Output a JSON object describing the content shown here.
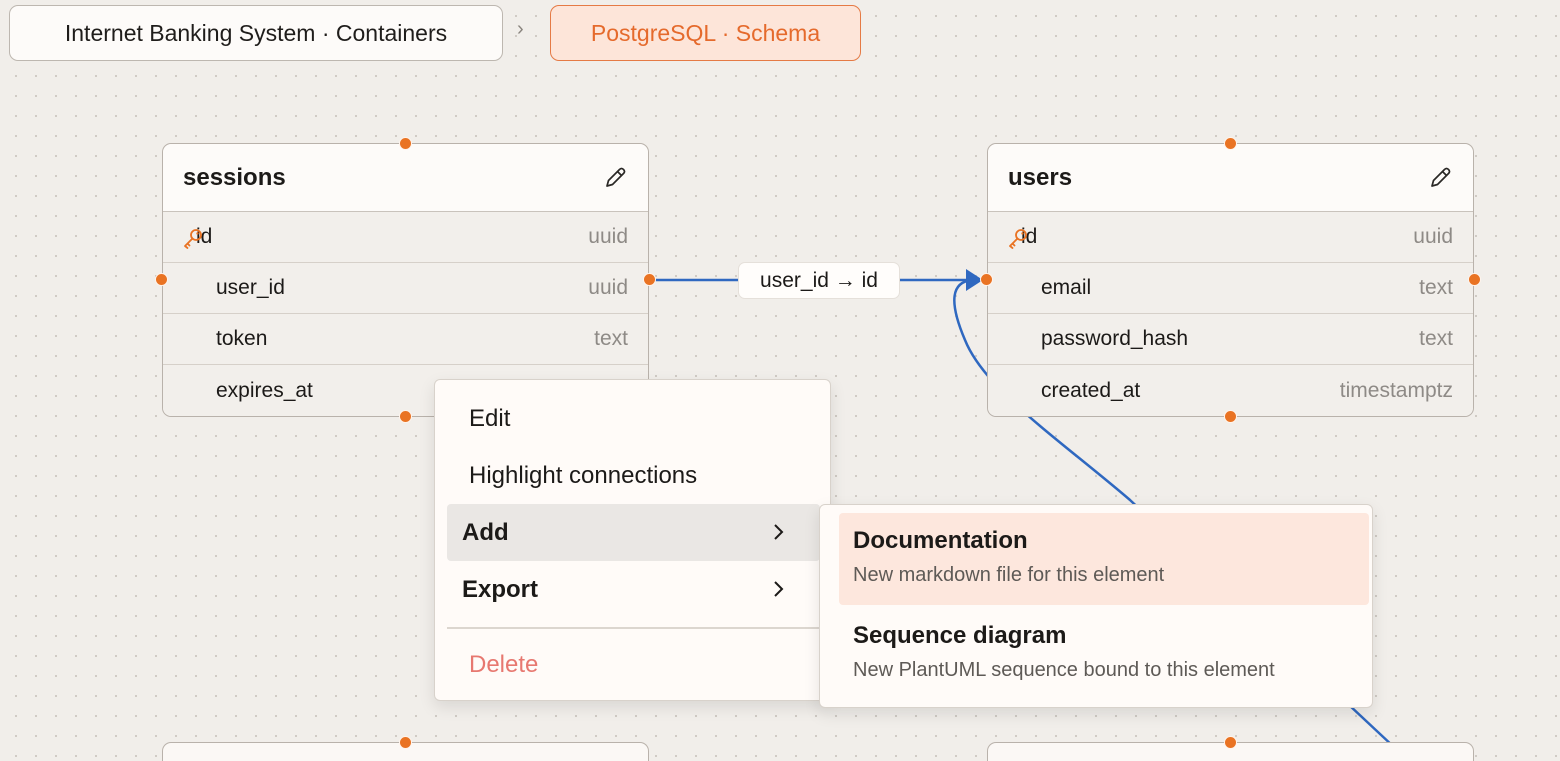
{
  "breadcrumb": {
    "items": [
      "Internet Banking System · Containers",
      "PostgreSQL · Schema"
    ],
    "separator": "›"
  },
  "tables": {
    "sessions": {
      "name": "sessions",
      "columns": [
        {
          "name": "id",
          "type": "uuid",
          "primary_key": true
        },
        {
          "name": "user_id",
          "type": "uuid"
        },
        {
          "name": "token",
          "type": "text"
        },
        {
          "name": "expires_at",
          "type": ""
        }
      ]
    },
    "users": {
      "name": "users",
      "columns": [
        {
          "name": "id",
          "type": "uuid",
          "primary_key": true
        },
        {
          "name": "email",
          "type": "text"
        },
        {
          "name": "password_hash",
          "type": "text"
        },
        {
          "name": "created_at",
          "type": "timestamptz"
        }
      ]
    }
  },
  "edge": {
    "label": "user_id → id"
  },
  "context_menu": {
    "items": [
      "Edit",
      "Highlight connections",
      "Add",
      "Export",
      "Delete"
    ],
    "active_item": "Add"
  },
  "submenu": {
    "items": [
      {
        "title": "Documentation",
        "description": "New markdown file for this element"
      },
      {
        "title": "Sequence diagram",
        "description": "New PlantUML sequence bound to this element"
      }
    ],
    "active_item": "Documentation"
  },
  "colors": {
    "accent": "#e97323",
    "edge": "#2f68c0",
    "danger": "#e77870",
    "canvas": "#f1eeea"
  },
  "icons": [
    "pencil-icon",
    "key-icon",
    "chevron-right-icon",
    "arrowhead-icon"
  ]
}
